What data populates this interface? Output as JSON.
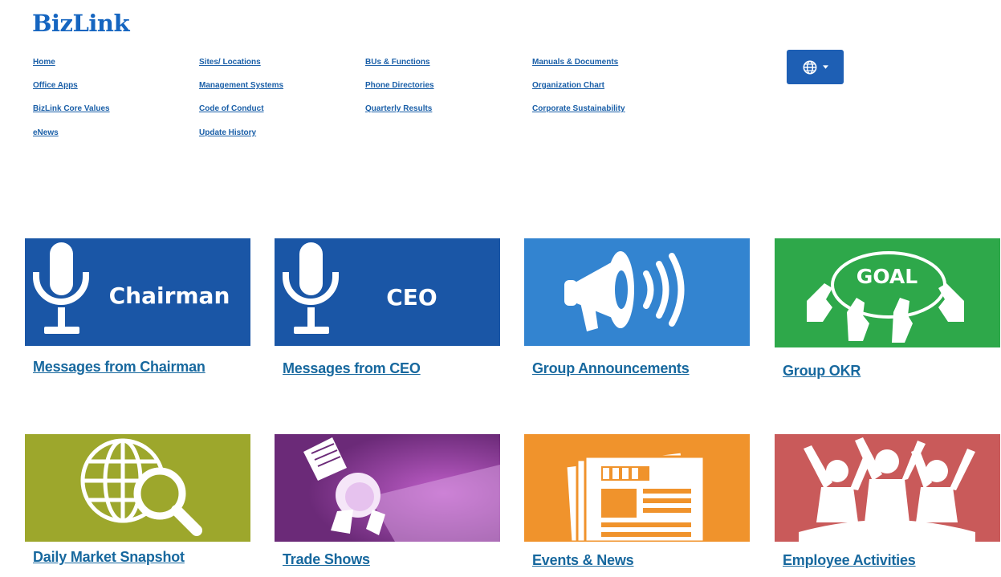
{
  "brand": {
    "logo_text": "BizLink"
  },
  "nav": {
    "col1": [
      "Home",
      "Office Apps",
      "BizLink Core Values",
      "eNews"
    ],
    "col2": [
      "Sites/ Locations",
      "Management Systems",
      "Code of Conduct",
      "Update History"
    ],
    "col3": [
      "BUs & Functions",
      "Phone Directories",
      "Quarterly Results"
    ],
    "col4": [
      "Manuals & Documents",
      "Organization Chart",
      "Corporate Sustainability"
    ]
  },
  "language_button": {
    "icon": "globe-icon",
    "caret": "chevron-down-icon"
  },
  "tiles": [
    {
      "title": "Messages from Chairman",
      "image_text": "Chairman",
      "icon": "microphone-icon",
      "bg": "#1a56a6"
    },
    {
      "title": "Messages from CEO",
      "image_text": "CEO",
      "icon": "microphone-icon",
      "bg": "#1a56a6"
    },
    {
      "title": "Group Announcements",
      "icon": "megaphone-icon",
      "bg": "#3384d0"
    },
    {
      "title": "Group OKR",
      "image_text": "GOAL",
      "icon": "goal-hands-icon",
      "bg": "#2ea84a"
    },
    {
      "title": "Daily Market Snapshot",
      "icon": "globe-search-icon",
      "bg": "#9da72c"
    },
    {
      "title": "Trade Shows",
      "icon": "spotlight-icon",
      "bg": "#6b2a78"
    },
    {
      "title": "Events & News",
      "icon": "newspaper-icon",
      "bg": "#f0932c"
    },
    {
      "title": "Employee Activities",
      "icon": "cheering-people-icon",
      "bg": "#c95a5a"
    }
  ]
}
